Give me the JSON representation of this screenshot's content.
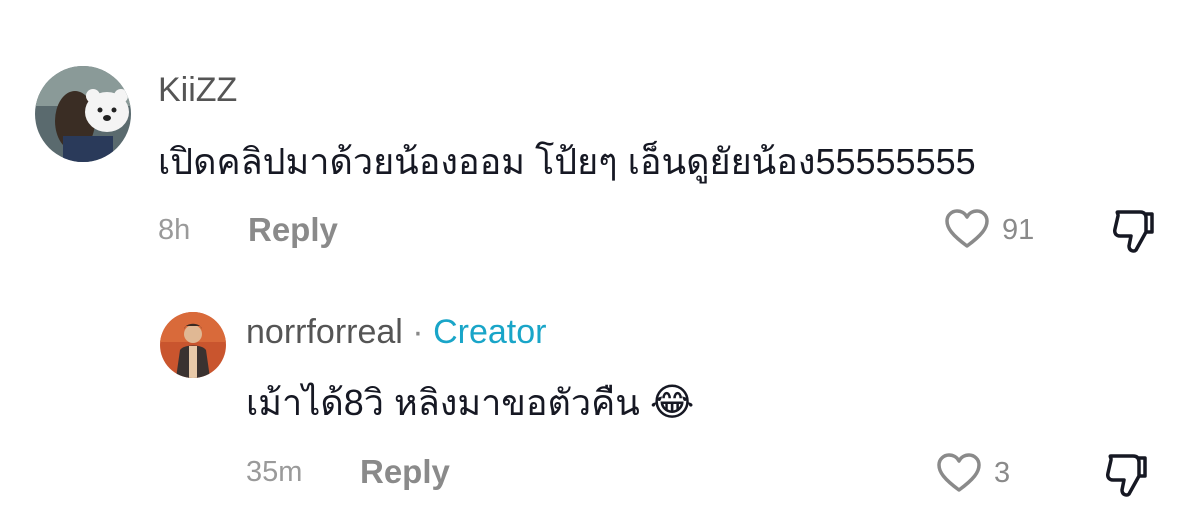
{
  "comments": [
    {
      "username": "KiiZZ",
      "text": "เปิดคลิปมาด้วยน้องออม โป้ยๆ เอ็นดูยัยน้อง55555555",
      "time": "8h",
      "reply_label": "Reply",
      "like_count": "91"
    }
  ],
  "replies": [
    {
      "username": "norrforreal",
      "separator": "·",
      "badge": "Creator",
      "text": "เม้าได้8วิ หลิงมาขอตัวคืน",
      "emoji": "😂",
      "time": "35m",
      "reply_label": "Reply",
      "like_count": "3"
    }
  ],
  "colors": {
    "creator_badge": "#19a5c8",
    "text": "#161823",
    "meta": "#8a8a8a"
  },
  "icons": [
    "heart-icon",
    "dislike-icon"
  ]
}
